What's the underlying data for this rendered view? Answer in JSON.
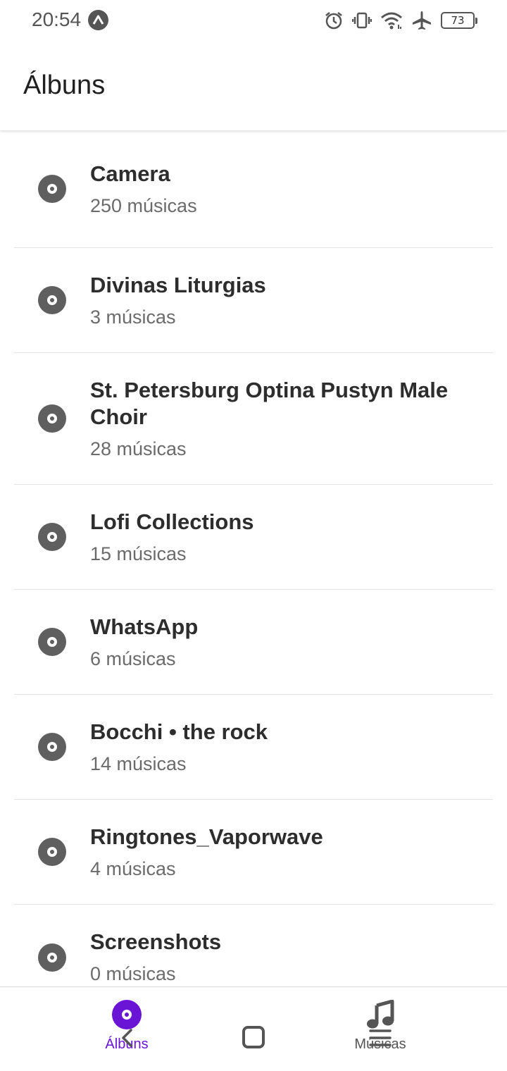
{
  "status_bar": {
    "time": "20:54",
    "battery_level": "73",
    "icons": [
      "app-notification-icon",
      "alarm-icon",
      "vibrate-icon",
      "wifi-icon",
      "airplane-icon",
      "battery-icon"
    ]
  },
  "app_bar": {
    "title": "Álbuns"
  },
  "albums": [
    {
      "title": "Camera",
      "count": "250 músicas"
    },
    {
      "title": "Divinas Liturgias",
      "count": "3 músicas"
    },
    {
      "title": "St. Petersburg Optina Pustyn Male Choir",
      "count": "28 músicas"
    },
    {
      "title": "Lofi Collections",
      "count": "15 músicas"
    },
    {
      "title": "WhatsApp",
      "count": "6 músicas"
    },
    {
      "title": "Bocchi • the rock",
      "count": "14 músicas"
    },
    {
      "title": "Ringtones_Vaporwave",
      "count": "4 músicas"
    },
    {
      "title": "Screenshots",
      "count": "0 músicas"
    }
  ],
  "bottom_nav": {
    "tabs": [
      {
        "label": "Álbuns",
        "icon": "disc-icon",
        "active": true
      },
      {
        "label": "Músicas",
        "icon": "music-note-icon",
        "active": false
      }
    ]
  },
  "colors": {
    "accent": "#6a14d6",
    "icon_gray": "#5f5f5f",
    "divider": "#e3e3e3"
  }
}
